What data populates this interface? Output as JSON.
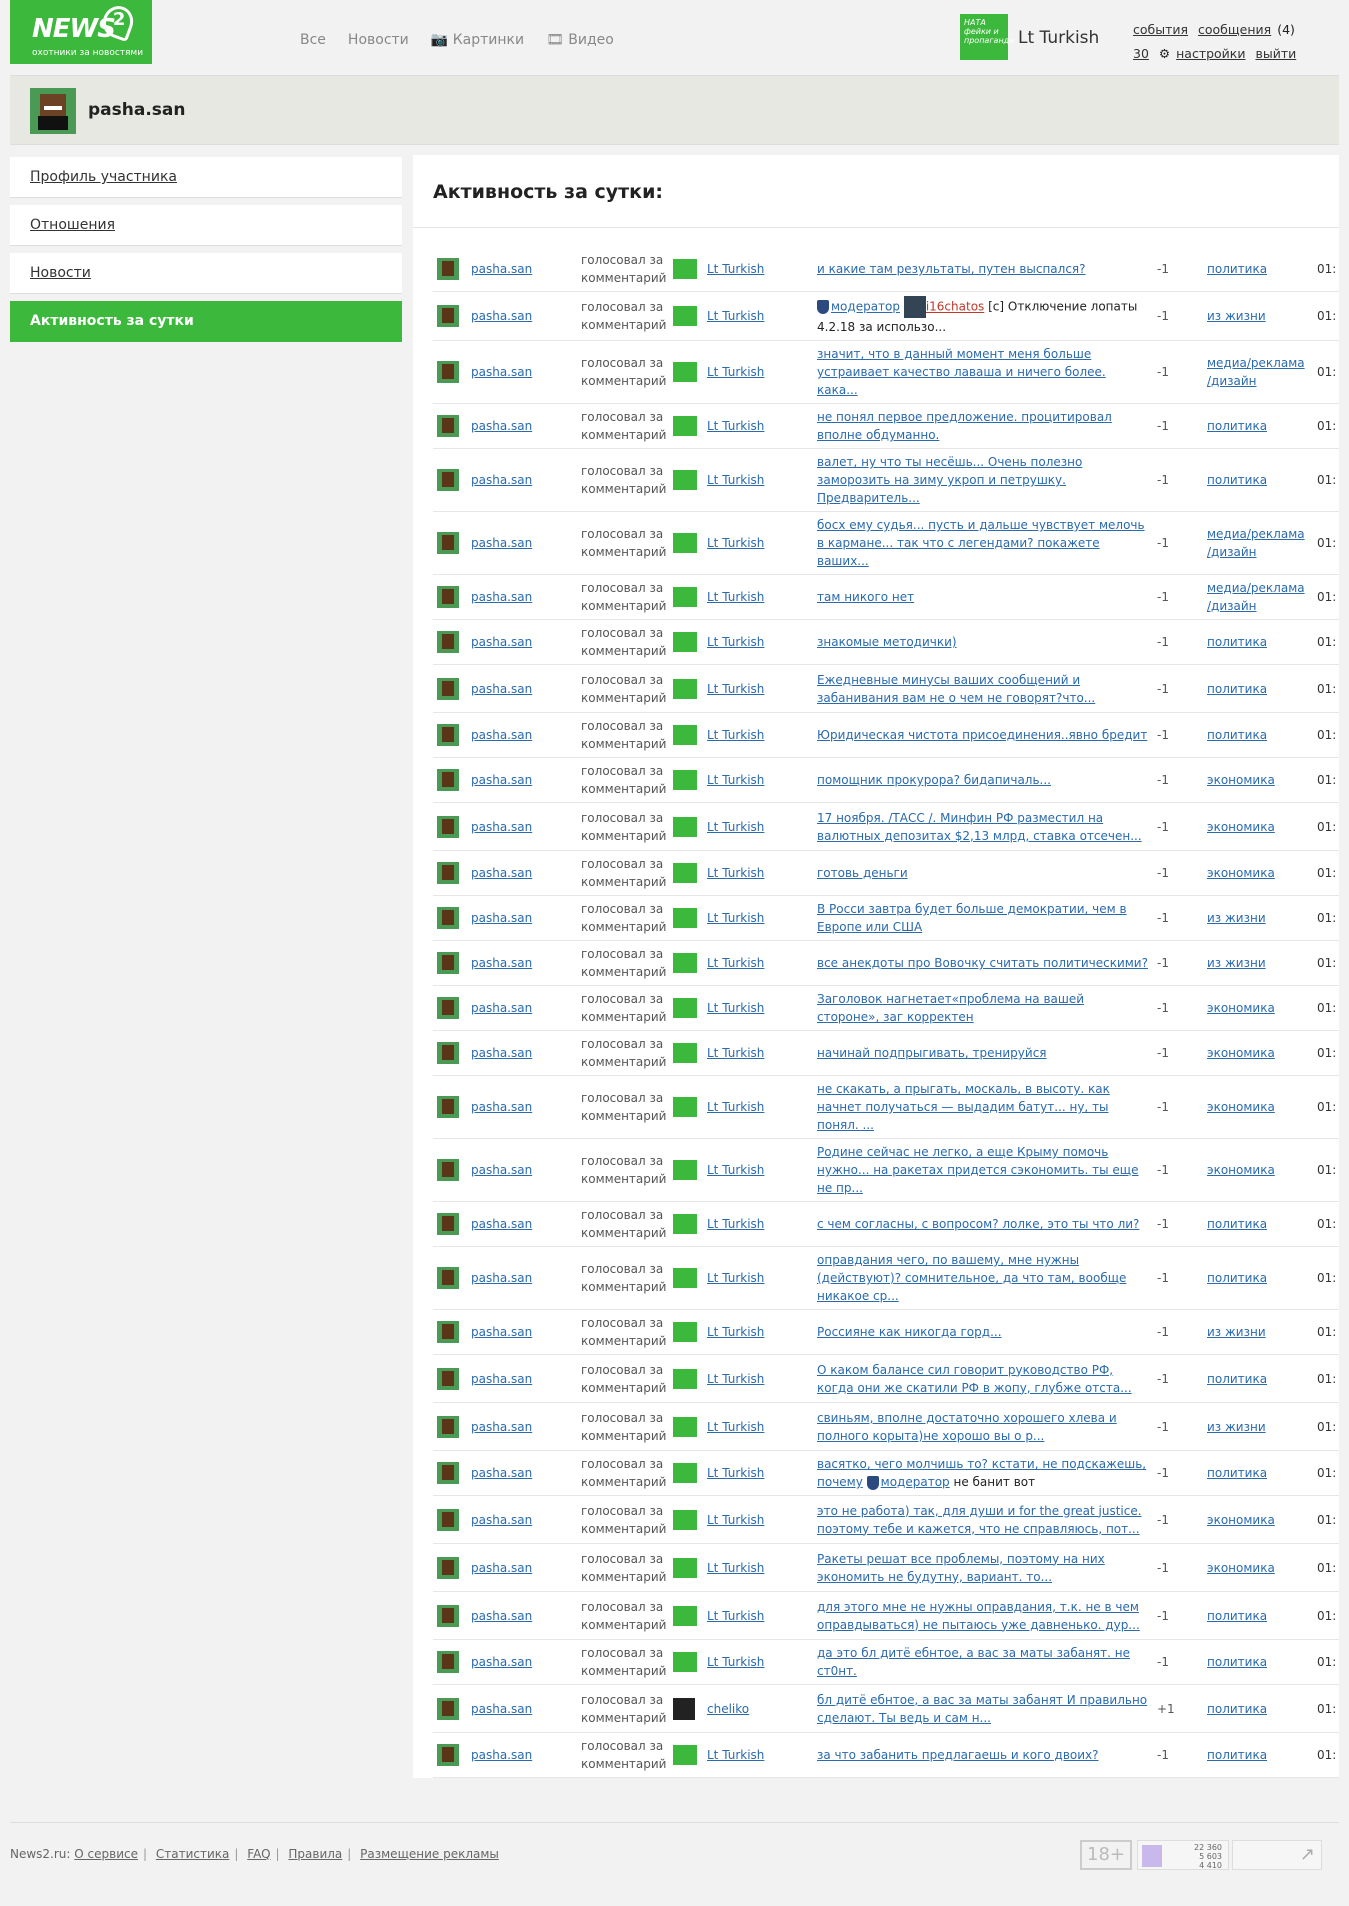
{
  "header": {
    "logo_text": "NEWS",
    "logo_num": "2",
    "logo_tagline": "охотники за новостями",
    "nav": [
      "Все",
      "Новости",
      "Картинки",
      "Видео"
    ],
    "user_badge": "НАТА фейки и пропаганда",
    "username": "Lt Turkish",
    "events": "события",
    "messages": "сообщения",
    "messages_count": "(4)",
    "karma": "30",
    "settings": "настройки",
    "logout": "выйти"
  },
  "profile": {
    "name": "pasha.san"
  },
  "sidebar": {
    "items": [
      {
        "label": "Профиль участника",
        "active": false
      },
      {
        "label": "Отношения",
        "active": false
      },
      {
        "label": "Новости",
        "active": false
      },
      {
        "label": "Активность за сутки",
        "active": true
      }
    ]
  },
  "main": {
    "title": "Активность за сутки:",
    "action_label": "голосовал за комментарий",
    "rows": [
      {
        "target": "Lt Turkish",
        "comment": "и какие там результаты, путен выспался?",
        "score": "-1",
        "category": "политика"
      },
      {
        "target": "Lt Turkish",
        "comment": "[c] Отключение лопаты 4.2.18 за использо...",
        "score": "-1",
        "category": "из жизни",
        "mod": true
      },
      {
        "target": "Lt Turkish",
        "comment": "значит, что в данный момент меня больше устраивает качество лаваша и ничего более. кака...",
        "score": "-1",
        "category": "медиа/реклама /дизайн"
      },
      {
        "target": "Lt Turkish",
        "comment": "не понял первое предложение. процитировал вполне обдуманно.",
        "score": "-1",
        "category": "политика"
      },
      {
        "target": "Lt Turkish",
        "comment": "валет, ну что ты несёшь... Очень полезно заморозить на зиму укроп и петрушку. Предваритель...",
        "score": "-1",
        "category": "политика"
      },
      {
        "target": "Lt Turkish",
        "comment": "босх ему судья... пусть и дальше чувствует мелочь в кармане... так что с легендами? покажете ваших...",
        "score": "-1",
        "category": "медиа/реклама /дизайн"
      },
      {
        "target": "Lt Turkish",
        "comment": "там никого нет",
        "score": "-1",
        "category": "медиа/реклама /дизайн"
      },
      {
        "target": "Lt Turkish",
        "comment": "знакомые методички)",
        "score": "-1",
        "category": "политика"
      },
      {
        "target": "Lt Turkish",
        "comment": "Ежедневные минусы ваших сообщений и забанивания вам не о чем не говорят?что...",
        "score": "-1",
        "category": "политика"
      },
      {
        "target": "Lt Turkish",
        "comment": "Юридическая чистота присоединения..явно бредит",
        "score": "-1",
        "category": "политика"
      },
      {
        "target": "Lt Turkish",
        "comment": "помощник прокурора? бидапичаль...",
        "score": "-1",
        "category": "экономика"
      },
      {
        "target": "Lt Turkish",
        "comment": "17 ноября. /ТАСС /. Минфин РФ разместил на валютных депозитах $2,13 млрд, ставка отсечен...",
        "score": "-1",
        "category": "экономика"
      },
      {
        "target": "Lt Turkish",
        "comment": "готовь деньги",
        "score": "-1",
        "category": "экономика"
      },
      {
        "target": "Lt Turkish",
        "comment": "В Росси завтра будет больше демократии, чем в Европе или США",
        "score": "-1",
        "category": "из жизни"
      },
      {
        "target": "Lt Turkish",
        "comment": "все анекдоты про Вовочку считать политическими?",
        "score": "-1",
        "category": "из жизни"
      },
      {
        "target": "Lt Turkish",
        "comment": "Заголовок нагнетает«проблема на вашей стороне», заг корректен",
        "score": "-1",
        "category": "экономика"
      },
      {
        "target": "Lt Turkish",
        "comment": "начинай подпрыгивать, тренируйся",
        "score": "-1",
        "category": "экономика"
      },
      {
        "target": "Lt Turkish",
        "comment": "не скакать, а прыгать, москаль, в высоту. как начнет получаться — выдадим батут... ну, ты понял. ...",
        "score": "-1",
        "category": "экономика"
      },
      {
        "target": "Lt Turkish",
        "comment": "Родине сейчас не легко, а еще Крыму помочь нужно... на ракетах придется сэкономить. ты еще не пр...",
        "score": "-1",
        "category": "экономика"
      },
      {
        "target": "Lt Turkish",
        "comment": "с чем согласны, с вопросом? лолке, это ты что ли?",
        "score": "-1",
        "category": "политика"
      },
      {
        "target": "Lt Turkish",
        "comment": "оправдания чего, по вашему, мне нужны (действуют)? сомнительное, да что там, вообще никакое ср...",
        "score": "-1",
        "category": "политика"
      },
      {
        "target": "Lt Turkish",
        "comment": "Россияне как никогда горд...",
        "score": "-1",
        "category": "из жизни"
      },
      {
        "target": "Lt Turkish",
        "comment": "О каком балансе сил говорит руководство РФ, когда они же скатили РФ в жопу, глубже отста...",
        "score": "-1",
        "category": "политика"
      },
      {
        "target": "Lt Turkish",
        "comment": "свиньям, вполне достаточно хорошего хлева и полного корыта)не хорошо вы о р...",
        "score": "-1",
        "category": "из жизни"
      },
      {
        "target": "Lt Turkish",
        "comment": "васятко, чего молчишь то? кстати, не подскажешь, почему",
        "comment_mod": "модератор",
        "comment_tail": "не банит вот",
        "score": "-1",
        "category": "политика"
      },
      {
        "target": "Lt Turkish",
        "comment": "это не работа) так, для души и for the great justice. поэтому тебе и кажется, что не справляюсь, пот...",
        "score": "-1",
        "category": "экономика"
      },
      {
        "target": "Lt Turkish",
        "comment": "Ракеты решат все проблемы, поэтому на них экономить не будутну, вариант. то...",
        "score": "-1",
        "category": "экономика"
      },
      {
        "target": "Lt Turkish",
        "comment": "для этого мне не нужны оправдания, т.к. не в чем оправдываться) не пытаюсь уже давненько. дур...",
        "score": "-1",
        "category": "политика"
      },
      {
        "target": "Lt Turkish",
        "comment": "да это бл дитё ебнтое, а вас за маты забанят. не ст0нт.",
        "score": "-1",
        "category": "политика"
      },
      {
        "target": "cheliko",
        "comment": "бл дитё ебнтое, а вас за маты забанят И правильно сделают. Ты ведь и сам н...",
        "score": "+1",
        "category": "политика"
      },
      {
        "target": "Lt Turkish",
        "comment": "за что забанить предлагаешь и кого двоих?",
        "score": "-1",
        "category": "политика"
      }
    ],
    "mod_label": "модератор",
    "mod_user": "i16chatos",
    "time_prefix": "01:"
  },
  "footer": {
    "site": "News2.ru:",
    "links": [
      "О сервисе",
      "Статистика",
      "FAQ",
      "Правила",
      "Размещение рекламы"
    ],
    "age": "18+",
    "counter_lines": [
      "22 360",
      "5 603",
      "4 410"
    ]
  }
}
